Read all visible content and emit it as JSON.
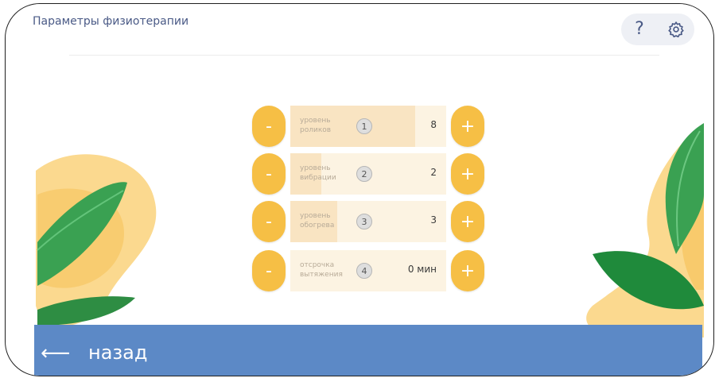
{
  "header": {
    "title": "Параметры физиотерапии",
    "help_icon": "?",
    "settings_icon": "gear-icon"
  },
  "colors": {
    "accent": "#f6bf45",
    "bar": "#5c89c6",
    "title": "#4a5a86",
    "leaf_green": "#2f9a48"
  },
  "params": [
    {
      "number": "1",
      "label_line1": "уровень",
      "label_line2": "роликов",
      "value": "8",
      "level": 0.8,
      "minus": "-",
      "plus": "+"
    },
    {
      "number": "2",
      "label_line1": "уровень",
      "label_line2": "вибрации",
      "value": "2",
      "level": 0.2,
      "minus": "-",
      "plus": "+"
    },
    {
      "number": "3",
      "label_line1": "уровень",
      "label_line2": "обогрева",
      "value": "3",
      "level": 0.3,
      "minus": "-",
      "plus": "+"
    },
    {
      "number": "4",
      "label_line1": "отсрочка",
      "label_line2": "вытяжения",
      "value": "0 мин",
      "level": 0,
      "minus": "-",
      "plus": "+"
    }
  ],
  "footer": {
    "back_arrow": "⟵",
    "back_label": "назад"
  }
}
